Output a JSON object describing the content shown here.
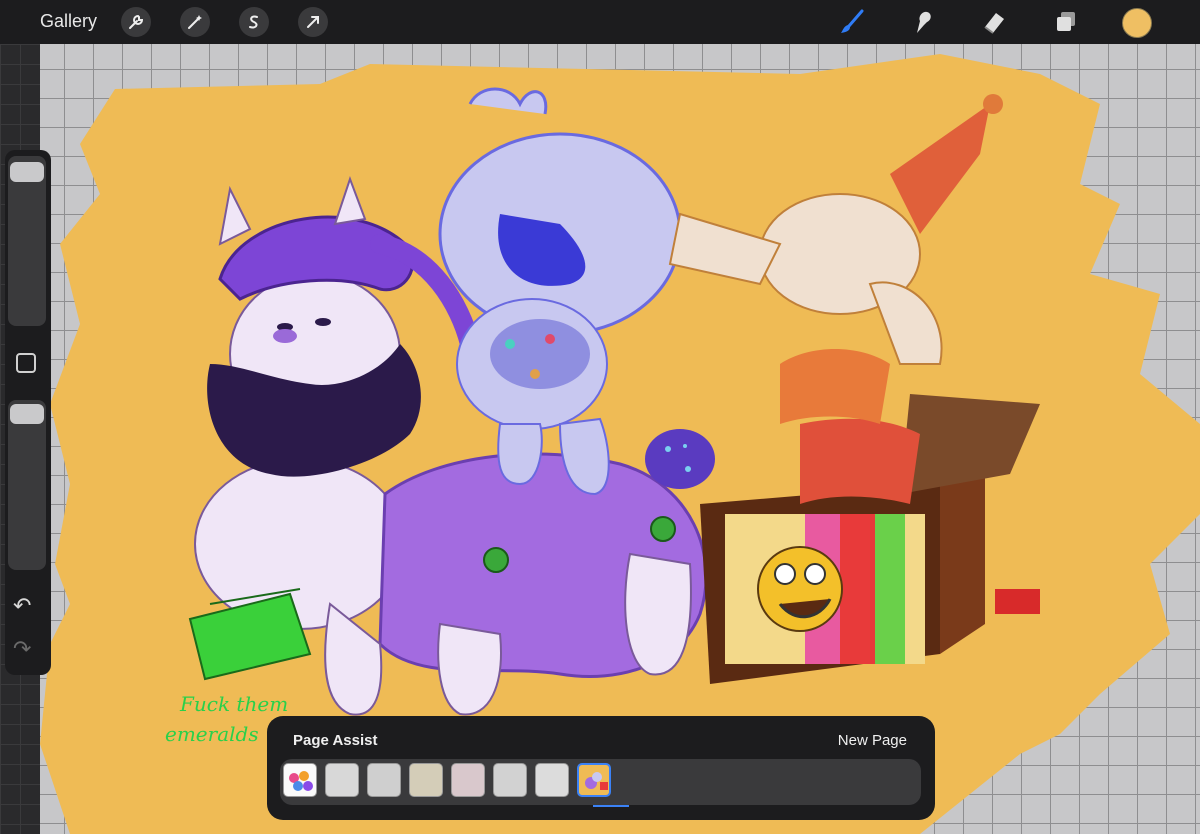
{
  "app": {
    "gallery_label": "Gallery",
    "left_tools": [
      "wrench-icon",
      "magic-wand-icon",
      "selection-icon",
      "transform-arrow-icon"
    ],
    "right_tools": [
      "brush-icon",
      "smudge-icon",
      "eraser-icon",
      "layers-icon"
    ],
    "current_color": "#efbf63",
    "accent_color": "#2f7cf6"
  },
  "canvas": {
    "background_color": "#c7c7c9",
    "paint_color": "#efbb55",
    "handwritten_note": "Fuck them emeralds"
  },
  "page_assist": {
    "title": "Page Assist",
    "new_page_label": "New Page",
    "page_count": 8,
    "selected_page": 8
  }
}
